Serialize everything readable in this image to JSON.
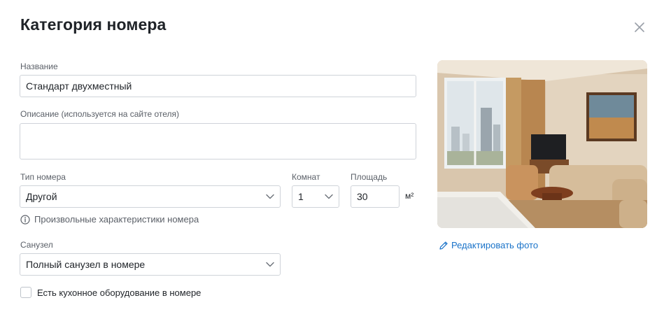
{
  "dialog": {
    "title": "Категория номера",
    "close_icon": "close-icon"
  },
  "form": {
    "name_label": "Название",
    "name_value": "Стандарт двухместный",
    "description_label": "Описание (используется на сайте отеля)",
    "description_value": "",
    "room_type_label": "Тип номера",
    "room_type_value": "Другой",
    "rooms_label": "Комнат",
    "rooms_value": "1",
    "area_label": "Площадь",
    "area_value": "30",
    "area_unit": "м²",
    "hint_icon": "info-icon",
    "hint_text": "Произвольные характеристики номера",
    "bathroom_label": "Санузел",
    "bathroom_value": "Полный санузел в номере",
    "kitchen_checkbox_label": "Есть кухонное оборудование в номере",
    "kitchen_checked": false
  },
  "photo": {
    "edit_label": "Редактировать фото",
    "edit_icon": "pencil-icon"
  },
  "colors": {
    "accent_link": "#1a73c9",
    "border": "#cfd3d9",
    "text": "#1f2328",
    "muted": "#5b6068"
  }
}
